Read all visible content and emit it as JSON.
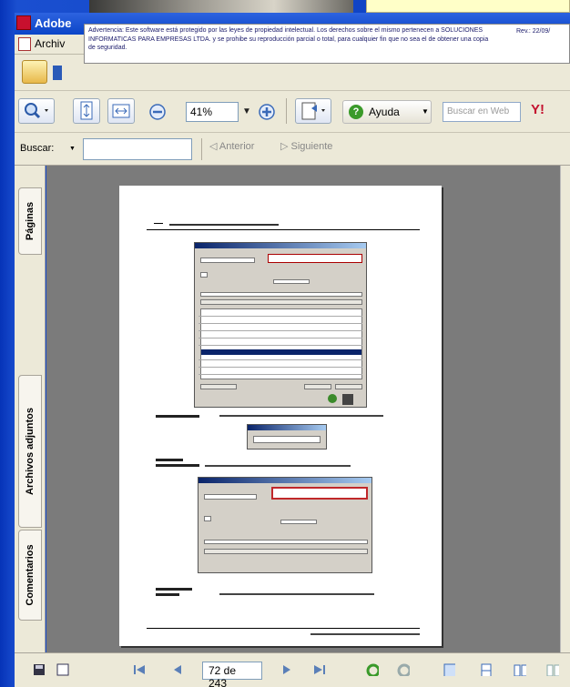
{
  "window": {
    "title": "Adobe"
  },
  "menu": {
    "archivo": "Archiv"
  },
  "warning": {
    "text": "Advertencia: Este software está protegido por las leyes de propiedad intelectual. Los derechos sobre el mismo pertenecen a SOLUCIONES INFORMATICAS PARA EMPRESAS LTDA. y se prohibe su reproducción parcial o total, para cualquier fin que no sea el de obtener una copia de seguridad.",
    "rev": "Rev.: 22/09/"
  },
  "toolbar": {
    "zoom": "41%",
    "help": "Ayuda",
    "search_web_placeholder": "Buscar en Web",
    "yahoo": "Y!"
  },
  "find": {
    "label": "Buscar:",
    "prev": "Anterior",
    "next": "Siguiente"
  },
  "tabs": [
    "Páginas",
    "Archivos adjuntos",
    "Comentarios"
  ],
  "status": {
    "page": "72 de 243"
  },
  "colors": {
    "frame": "#0a3ec0",
    "chrome": "#ece9d8",
    "doc_bg": "#7b7b7b"
  }
}
